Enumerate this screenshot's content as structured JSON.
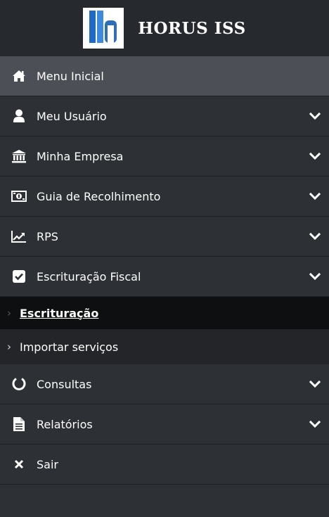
{
  "brand": {
    "title": "HORUS ISS",
    "logo_icon": "horus-logo-icon"
  },
  "colors": {
    "background": "#2d3035",
    "header": "#26292e",
    "active_item": "#4c5056",
    "current_subitem": "#0e0f11",
    "subitem": "#232529"
  },
  "menu": {
    "items": [
      {
        "label": "Menu Inicial",
        "icon": "home-icon",
        "active": true,
        "expandable": false
      },
      {
        "label": "Meu Usuário",
        "icon": "user-icon",
        "active": false,
        "expandable": true
      },
      {
        "label": "Minha Empresa",
        "icon": "bank-icon",
        "active": false,
        "expandable": true
      },
      {
        "label": "Guia de Recolhimento",
        "icon": "money-icon",
        "active": false,
        "expandable": true
      },
      {
        "label": "RPS",
        "icon": "chart-line-icon",
        "active": false,
        "expandable": true
      },
      {
        "label": "Escrituração Fiscal",
        "icon": "checkbox-icon",
        "active": false,
        "expandable": true,
        "expanded": true
      },
      {
        "label": "Consultas",
        "icon": "circle-notch-icon",
        "active": false,
        "expandable": true
      },
      {
        "label": "Relatórios",
        "icon": "file-icon",
        "active": false,
        "expandable": true
      },
      {
        "label": "Sair",
        "icon": "close-icon",
        "active": false,
        "expandable": false
      }
    ],
    "subitems": [
      {
        "label": "Escrituração",
        "current": true
      },
      {
        "label": "Importar serviços",
        "current": false
      }
    ]
  }
}
